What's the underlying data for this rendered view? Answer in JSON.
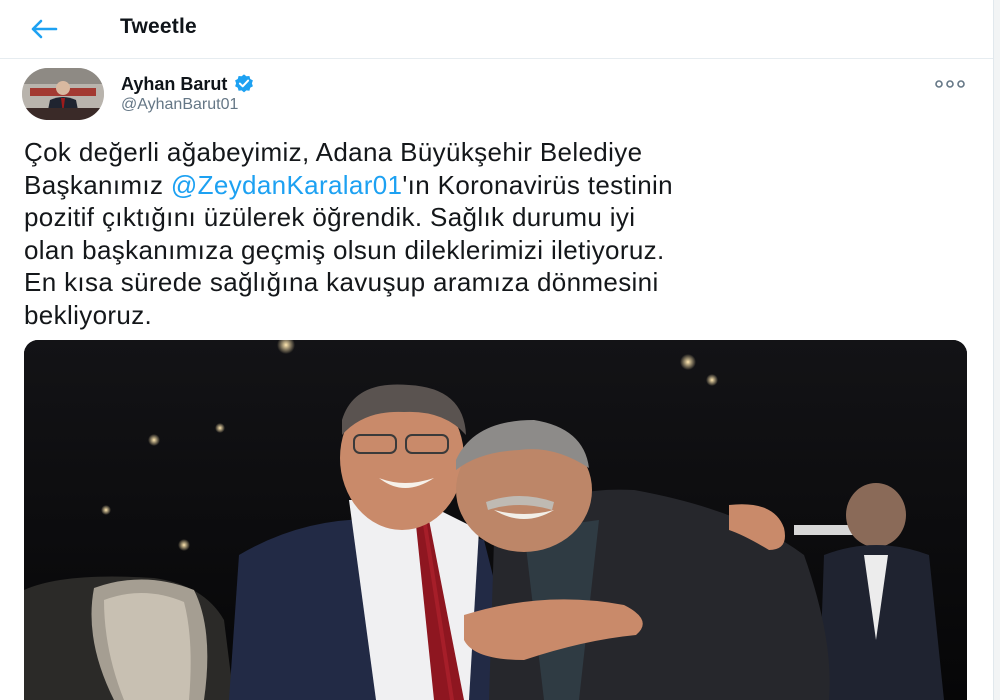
{
  "header": {
    "title": "Tweetle",
    "back_icon": "arrow-left-icon"
  },
  "author": {
    "name": "Ayhan Barut",
    "handle": "@AyhanBarut01",
    "verified_icon": "verified-badge-icon"
  },
  "tweet": {
    "lines": [
      {
        "before": "Çok değerli ağabeyimiz, Adana Büyükşehir Belediye",
        "mention": "",
        "after": ""
      },
      {
        "before": "Başkanımız ",
        "mention": "@ZeydanKaralar01",
        "after": "'ın Koronavirüs testinin"
      },
      {
        "before": "pozitif çıktığını üzülerek öğrendik. Sağlık durumu iyi",
        "mention": "",
        "after": ""
      },
      {
        "before": "olan başkanımıza geçmiş olsun dileklerimizi iletiyoruz.",
        "mention": "",
        "after": ""
      },
      {
        "before": "En kısa sürede sağlığına kavuşup aramıza dönmesini",
        "mention": "",
        "after": ""
      },
      {
        "before": "bekliyoruz.",
        "mention": "",
        "after": ""
      }
    ]
  },
  "colors": {
    "accent": "#1da1f2",
    "text": "#14171a",
    "secondary": "#657786"
  },
  "icons": {
    "more": "more-horizontal-icon"
  }
}
